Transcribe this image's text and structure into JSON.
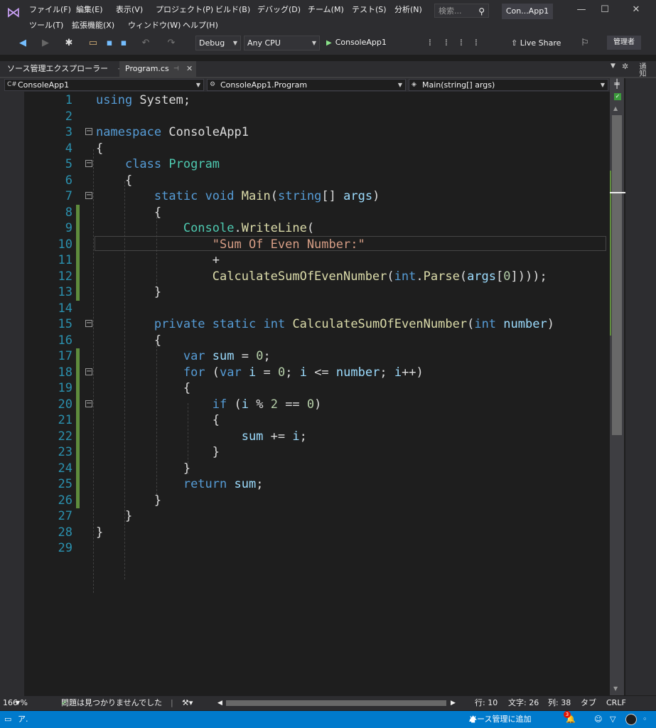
{
  "titlebar": {
    "menus_row1": [
      "ファイル(F)",
      "編集(E)",
      "表示(V)",
      "プロジェクト(P)",
      "ビルド(B)",
      "デバッグ(D)",
      "チーム(M)",
      "テスト(S)",
      "分析(N)"
    ],
    "menus_row2": [
      "ツール(T)",
      "拡張機能(X)",
      "ウィンドウ(W)",
      "ヘルプ(H)"
    ],
    "search_placeholder": "検索...",
    "window_title": "Con...App1",
    "minimize": "—",
    "maximize": "☐",
    "close": "✕"
  },
  "toolbar": {
    "configuration": "Debug",
    "platform": "Any CPU",
    "run_target": "ConsoleApp1",
    "live_share": "Live Share",
    "admin": "管理者"
  },
  "tabs": {
    "solution_explorer": "ソース管理エクスプローラー",
    "program": "Program.cs",
    "side_label": "通知"
  },
  "navbar": {
    "project": "ConsoleApp1",
    "class": "ConsoleApp1.Program",
    "member": "Main(string[] args)"
  },
  "editor": {
    "line_numbers": [
      "1",
      "2",
      "3",
      "4",
      "5",
      "6",
      "7",
      "8",
      "9",
      "10",
      "11",
      "12",
      "13",
      "14",
      "15",
      "16",
      "17",
      "18",
      "19",
      "20",
      "21",
      "22",
      "23",
      "24",
      "25",
      "26",
      "27",
      "28",
      "29"
    ]
  },
  "editstatus": {
    "zoom": "166 %",
    "issues": "問題は見つかりませんでした",
    "line": "行: 10",
    "char": "文字: 26",
    "col": "列: 38",
    "tab": "タブ",
    "eol": "CRLF"
  },
  "statusbar": {
    "left_text": "ア.",
    "source_control": "ソース管理に追加",
    "notifications_count": "3"
  },
  "colors": {
    "keyword": "#569cd6",
    "type": "#4ec9b0",
    "method": "#dcdcaa",
    "string": "#d69d85",
    "variable": "#9cdcfe",
    "number": "#b5cea8",
    "status_bar": "#007acc"
  }
}
